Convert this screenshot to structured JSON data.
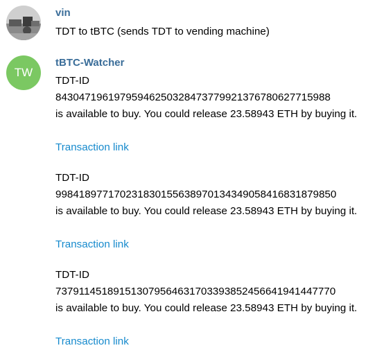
{
  "messages": [
    {
      "sender": "vin",
      "avatar_icon": "user-photo-avatar",
      "text": "TDT to tBTC (sends TDT to vending machine)"
    },
    {
      "sender": "tBTC-Watcher",
      "avatar_initials": "TW",
      "avatar_color": "#7bc862",
      "entries": [
        {
          "label": "TDT-ID",
          "id": "84304719619795946250328473779921376780627715988",
          "availability": "is available to buy. You could release 23.58943 ETH by buying it.",
          "link_text": "Transaction link"
        },
        {
          "label": "TDT-ID",
          "id": "99841897717023183015563897013434905841683187985​0",
          "availability": "is available to buy. You could release 23.58943 ETH by buying it.",
          "link_text": "Transaction link"
        },
        {
          "label": "TDT-ID",
          "id": "73791145189151307956463170339385245664194144777​0",
          "availability": "is available to buy. You could release 23.58943 ETH by buying it.",
          "link_text": "Transaction link"
        }
      ]
    }
  ],
  "colors": {
    "sender_name": "#3a6d99",
    "link": "#168acd",
    "text": "#000000"
  }
}
